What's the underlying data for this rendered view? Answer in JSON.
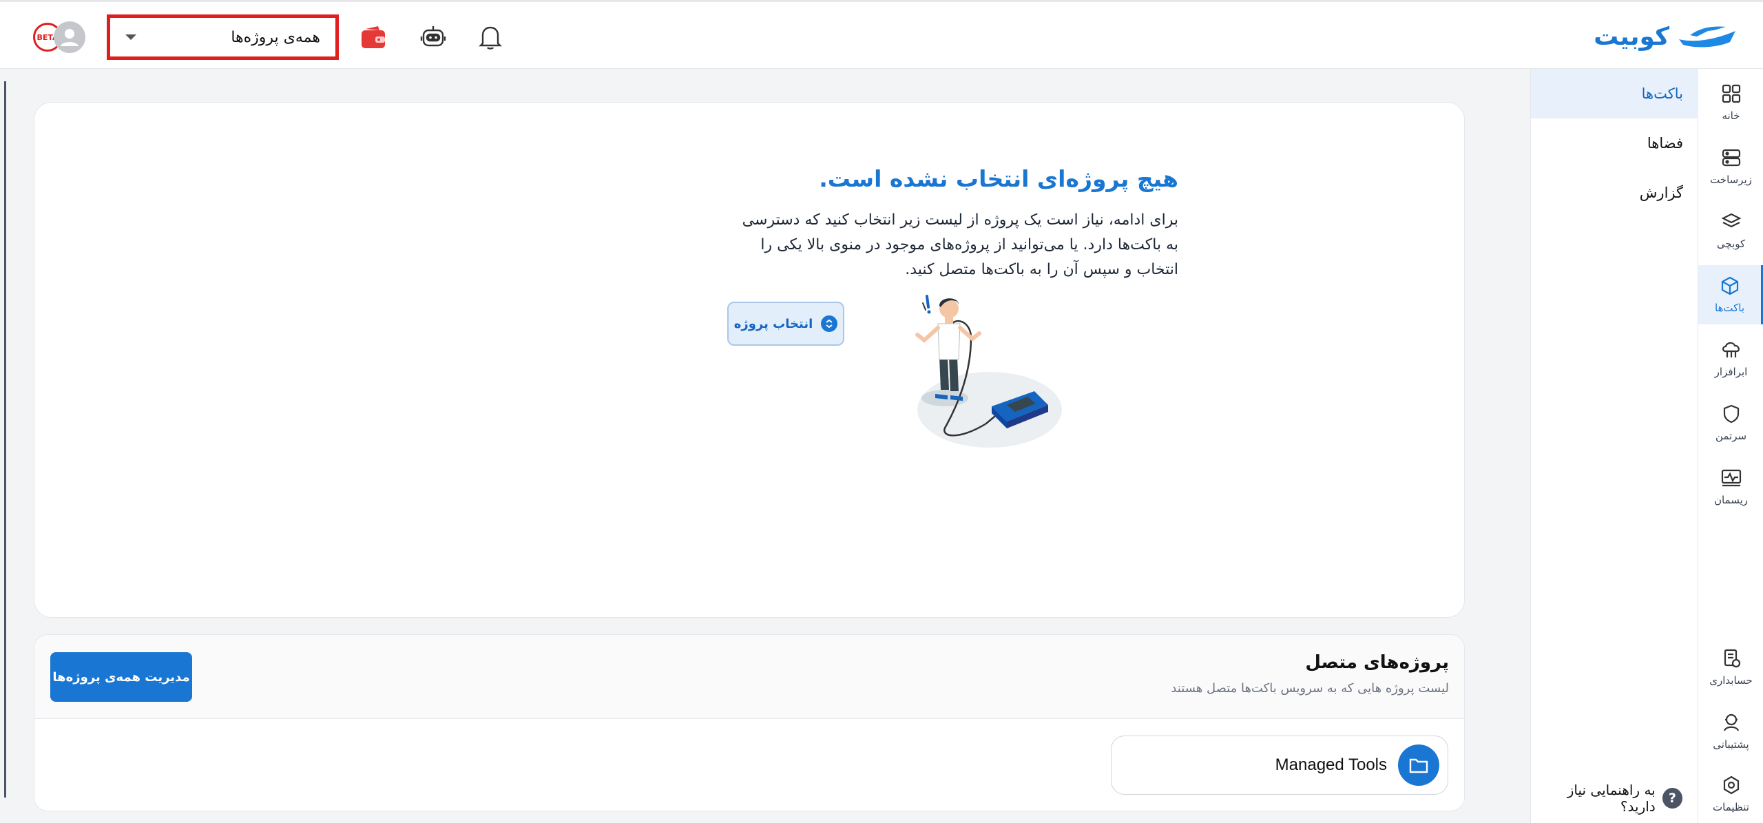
{
  "header": {
    "logo_text": "کوبیت",
    "project_selector": {
      "selected": "همه‌ی پروژه‌ها"
    },
    "avatar_badge_text": "BETA"
  },
  "rail": {
    "items": [
      {
        "label": "خانه",
        "icon": "grid-icon"
      },
      {
        "label": "زیرساخت",
        "icon": "server-icon"
      },
      {
        "label": "کوبچی",
        "icon": "layers-icon"
      },
      {
        "label": "باکت‌ها",
        "icon": "cube-icon"
      },
      {
        "label": "ابرافزار",
        "icon": "cloud-app-icon"
      },
      {
        "label": "سرتمن",
        "icon": "shield-icon"
      },
      {
        "label": "ریسمان",
        "icon": "pulse-icon"
      },
      {
        "label": "حسابداری",
        "icon": "receipt-icon"
      },
      {
        "label": "پشتیبانی",
        "icon": "support-icon"
      },
      {
        "label": "تنظیمات",
        "icon": "settings-icon"
      }
    ],
    "active_index": 3
  },
  "subnav": {
    "items": [
      {
        "label": "باکت‌ها"
      },
      {
        "label": "فضاها"
      },
      {
        "label": "گزارش"
      }
    ],
    "help_text": "به راهنمایی نیاز دارید؟",
    "help_icon_text": "?"
  },
  "empty_state": {
    "title": "هیچ پروژه‌ای انتخاب نشده است.",
    "description": "برای ادامه، نیاز است یک پروژه از لیست زیر انتخاب کنید که دسترسی به باکت‌ها دارد. یا می‌توانید از پروژه‌های موجود در منوی بالا یکی را انتخاب و سپس آن را به باکت‌ها متصل کنید.",
    "button_label": "انتخاب پروژه"
  },
  "connected_projects": {
    "title": "پروژه‌های متصل",
    "subtitle": "لیست پروژه هایی که به سرویس باکت‌ها متصل هستند",
    "manage_button": "مدیریت همه‌ی پروژه‌ها",
    "projects": [
      {
        "name": "Managed Tools"
      }
    ]
  },
  "colors": {
    "accent": "#1976d2",
    "highlight_border": "#e01e1e",
    "wallet": "#e53935"
  }
}
